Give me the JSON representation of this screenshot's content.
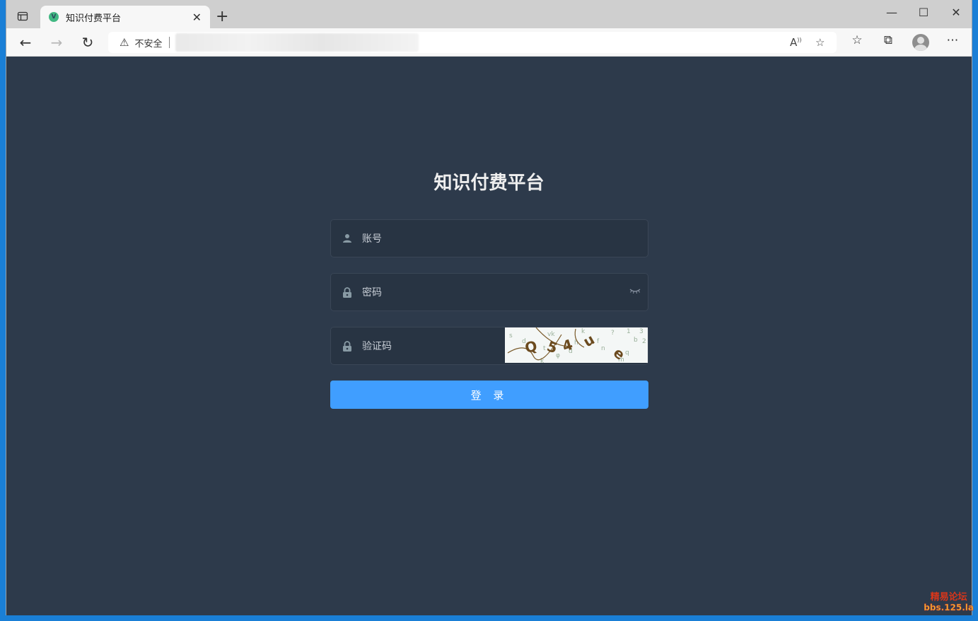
{
  "browser": {
    "tab": {
      "title": "知识付费平台",
      "favicon_letter": "V"
    },
    "address": {
      "security_label": "不安全",
      "url": ""
    }
  },
  "login": {
    "title": "知识付费平台",
    "username_placeholder": "账号",
    "password_placeholder": "密码",
    "captcha_placeholder": "验证码",
    "submit_label": "登 录",
    "captcha_text": "Q54ue"
  },
  "watermark": {
    "line1": "精易论坛",
    "line2": "bbs.125.la"
  },
  "colors": {
    "page_bg": "#2d3a4b",
    "input_bg": "#283443",
    "button_bg": "#409eff",
    "title": "#eeeeee"
  }
}
